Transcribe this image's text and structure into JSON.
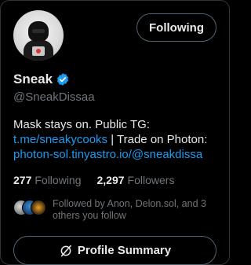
{
  "profile": {
    "display_name": "Sneak",
    "handle": "@SneakDissaa",
    "follow_button": "Following",
    "bio": {
      "line1": "Mask stays on. Public TG:",
      "line2_link": "t.me/sneakycooks",
      "line2_text": " | Trade on Photon:",
      "line3_link": "photon-sol.tinyastro.io/@sneakdissa"
    },
    "stats": {
      "following_count": "277",
      "following_label": "Following",
      "followers_count": "2,297",
      "followers_label": "Followers"
    },
    "followed_by": "Followed by Anon, Delon.sol, and 3 others you follow",
    "summary_button": "Profile Summary"
  },
  "colors": {
    "background": "#000000",
    "accent": "#1d9bf0",
    "muted": "#71767b",
    "text": "#e7e9ea",
    "border": "#536471"
  },
  "icons": {
    "verified": "verified-badge-icon",
    "summary": "grok-summary-icon"
  }
}
